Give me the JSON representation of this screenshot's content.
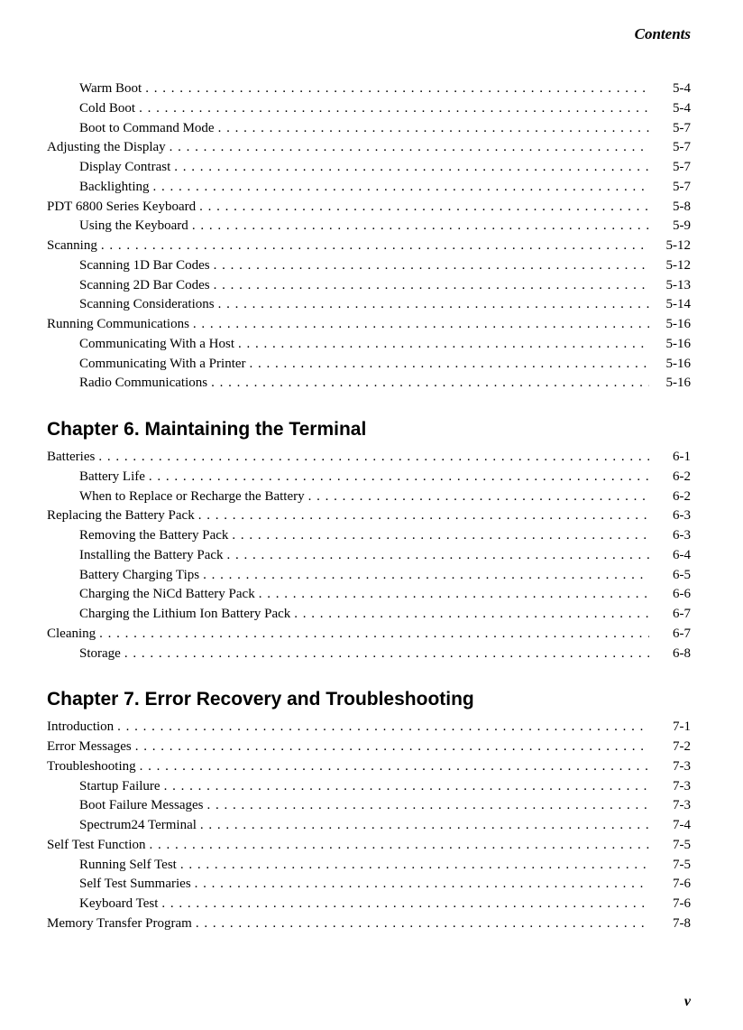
{
  "header": {
    "label": "Contents"
  },
  "sections": [
    {
      "entries": [
        {
          "label": "Warm Boot",
          "page": "5-4",
          "level": 2
        },
        {
          "label": "Cold Boot",
          "page": "5-4",
          "level": 2
        },
        {
          "label": "Boot to Command Mode",
          "page": "5-7",
          "level": 2
        },
        {
          "label": "Adjusting the Display",
          "page": "5-7",
          "level": 1
        },
        {
          "label": "Display Contrast",
          "page": "5-7",
          "level": 2
        },
        {
          "label": "Backlighting",
          "page": "5-7",
          "level": 2
        },
        {
          "label": "PDT 6800 Series Keyboard",
          "page": "5-8",
          "level": 1
        },
        {
          "label": "Using the Keyboard",
          "page": "5-9",
          "level": 2
        },
        {
          "label": "Scanning",
          "page": "5-12",
          "level": 1
        },
        {
          "label": "Scanning 1D Bar Codes",
          "page": "5-12",
          "level": 2
        },
        {
          "label": "Scanning 2D Bar Codes",
          "page": "5-13",
          "level": 2
        },
        {
          "label": "Scanning Considerations",
          "page": "5-14",
          "level": 2
        },
        {
          "label": "Running Communications",
          "page": "5-16",
          "level": 1
        },
        {
          "label": "Communicating With a Host",
          "page": "5-16",
          "level": 2
        },
        {
          "label": "Communicating With a Printer",
          "page": "5-16",
          "level": 2
        },
        {
          "label": "Radio Communications",
          "page": "5-16",
          "level": 2
        }
      ]
    },
    {
      "heading": "Chapter 6. Maintaining the Terminal",
      "entries": [
        {
          "label": "Batteries",
          "page": "6-1",
          "level": 1
        },
        {
          "label": "Battery Life",
          "page": "6-2",
          "level": 2
        },
        {
          "label": "When to Replace or Recharge the Battery",
          "page": "6-2",
          "level": 2
        },
        {
          "label": "Replacing the Battery Pack",
          "page": "6-3",
          "level": 1
        },
        {
          "label": "Removing the Battery Pack",
          "page": "6-3",
          "level": 2
        },
        {
          "label": "Installing the Battery Pack",
          "page": "6-4",
          "level": 2
        },
        {
          "label": "Battery Charging Tips",
          "page": "6-5",
          "level": 2
        },
        {
          "label": "Charging the NiCd Battery Pack",
          "page": "6-6",
          "level": 2
        },
        {
          "label": "Charging the Lithium Ion Battery Pack",
          "page": "6-7",
          "level": 2
        },
        {
          "label": "Cleaning",
          "page": "6-7",
          "level": 1
        },
        {
          "label": "Storage",
          "page": "6-8",
          "level": 2
        }
      ]
    },
    {
      "heading": "Chapter 7. Error Recovery and Troubleshooting",
      "entries": [
        {
          "label": "Introduction",
          "page": "7-1",
          "level": 1
        },
        {
          "label": "Error Messages",
          "page": "7-2",
          "level": 1
        },
        {
          "label": "Troubleshooting",
          "page": "7-3",
          "level": 1
        },
        {
          "label": "Startup Failure",
          "page": "7-3",
          "level": 2
        },
        {
          "label": "Boot Failure Messages",
          "page": "7-3",
          "level": 2
        },
        {
          "label": "Spectrum24 Terminal",
          "page": "7-4",
          "level": 2
        },
        {
          "label": "Self Test Function",
          "page": "7-5",
          "level": 1
        },
        {
          "label": "Running Self Test",
          "page": "7-5",
          "level": 2
        },
        {
          "label": "Self Test Summaries",
          "page": "7-6",
          "level": 2
        },
        {
          "label": "Keyboard Test",
          "page": "7-6",
          "level": 2
        },
        {
          "label": "Memory Transfer Program",
          "page": "7-8",
          "level": 1
        }
      ]
    }
  ],
  "footer": {
    "page_number": "v"
  }
}
